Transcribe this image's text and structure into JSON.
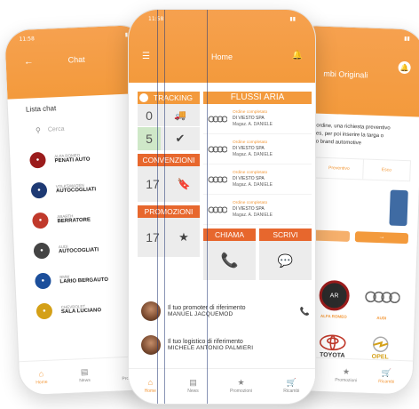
{
  "left_phone": {
    "status_time": "11:58",
    "header_title": "Chat",
    "list_title": "Lista chat",
    "search_placeholder": "Cerca",
    "chats": [
      {
        "brand": "ALFA ROMEO",
        "name": "PENATI AUTO",
        "color": "#9b1c1c"
      },
      {
        "brand": "VOLKSWAGEN",
        "name": "AUTOCOGLIATI",
        "color": "#1e3a74"
      },
      {
        "brand": "ABARTH",
        "name": "BERRATORE",
        "color": "#c0392b"
      },
      {
        "brand": "AUDI",
        "name": "AUTOCOGLIATI",
        "color": "#444444"
      },
      {
        "brand": "BMW",
        "name": "LARIO BERGAUTO",
        "color": "#1c4f9b"
      },
      {
        "brand": "CHEVROLET",
        "name": "SALA LUCIANO",
        "color": "#d4a017"
      }
    ],
    "tabs": [
      "Home",
      "News",
      "Promozioni"
    ]
  },
  "center_phone": {
    "status_time": "11:58",
    "header_title": "Home",
    "tracking": {
      "label": "TRACKING",
      "count_a": "0",
      "count_b": "5"
    },
    "flussi": {
      "label": "FLUSSI ARIA",
      "items": [
        {
          "status": "Ordine completato",
          "company": "DI VIESTO SPA",
          "warehouse": "Magaz. A. DANIELE"
        },
        {
          "status": "Ordine completato",
          "company": "DI VIESTO SPA",
          "warehouse": "Magaz. A. DANIELE"
        },
        {
          "status": "Ordine completato",
          "company": "DI VIESTO SPA",
          "warehouse": "Magaz. A. DANIELE"
        },
        {
          "status": "Ordine completato",
          "company": "DI VIESTO SPA",
          "warehouse": "Magaz. A. DANIELE"
        }
      ]
    },
    "convenzioni": {
      "label": "CONVENZIONI",
      "count": "17"
    },
    "promozioni": {
      "label": "PROMOZIONI",
      "count": "17"
    },
    "chiama_label": "CHIAMA",
    "scrivi_label": "SCRIVI",
    "promoter": {
      "role": "Il tuo promoter di riferimento",
      "name": "MANUEL JACQUEMOD"
    },
    "logistic": {
      "role": "Il tuo logistico di riferimento",
      "name": "MICHELE ANTONIO PALMIERI"
    },
    "tabs": [
      "Home",
      "News",
      "Promozioni",
      "Ricambi"
    ]
  },
  "right_phone": {
    "header_title": "mbi Originali",
    "notification_count": "3",
    "intro_line1": "ordine, una richiesta preventivo",
    "intro_line2": "es, per poi inserire la targa o",
    "intro_line3": "o brand automotive",
    "segment_labels": [
      "Preventivo",
      "Esco"
    ],
    "section_label": "al",
    "brands": [
      {
        "name": "ALFA ROMEO",
        "logo_text": "AR",
        "color": "#9b1c1c"
      },
      {
        "name": "AUDI",
        "logo_text": "",
        "color": "#555555"
      },
      {
        "name": "TOYOTA",
        "logo_text": "TOYOTA",
        "color": "#c0392b"
      },
      {
        "name": "OPEL",
        "logo_text": "OPEL",
        "color": "#d4a017"
      }
    ],
    "tabs": [
      "Promozioni",
      "Ricambi"
    ]
  }
}
